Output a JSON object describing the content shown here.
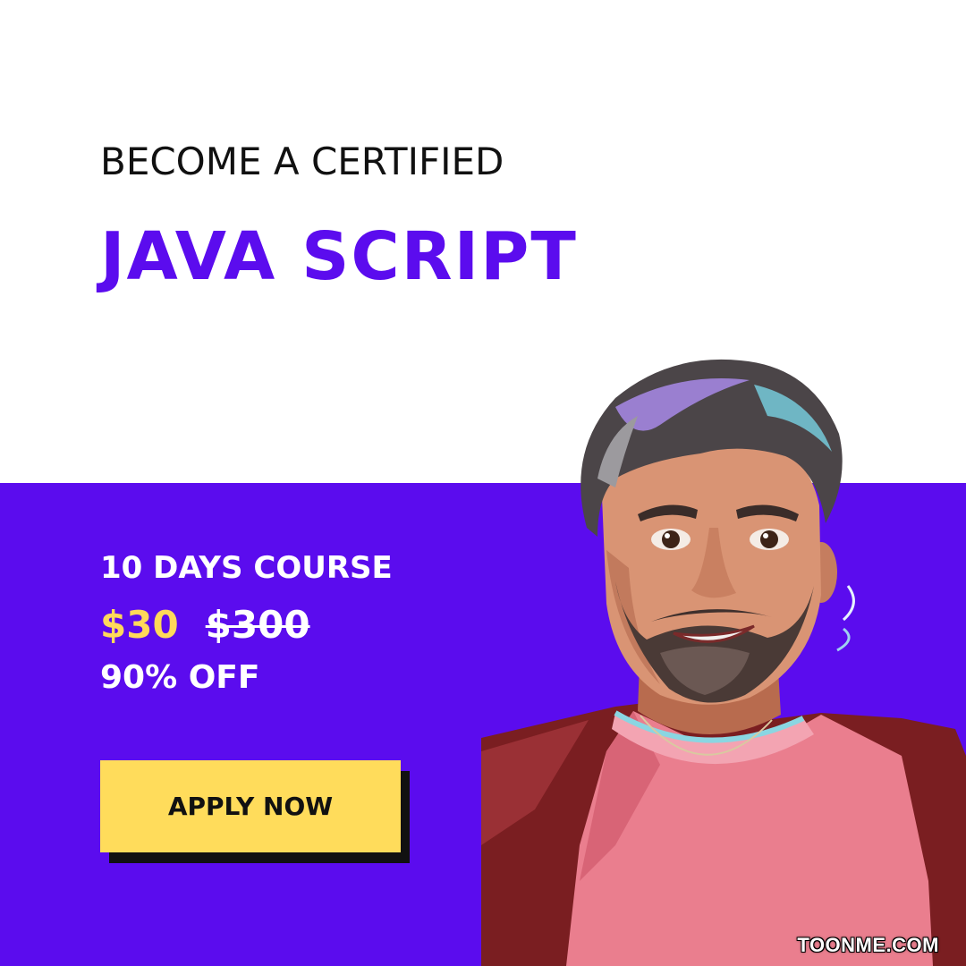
{
  "colors": {
    "brand_purple": "#5b0cee",
    "price_yellow": "#ffd95a",
    "button_yellow": "#ffdc5b",
    "text_dark": "#111111"
  },
  "header": {
    "eyebrow": "BECOME A CERTIFIED",
    "headline": "JAVA SCRIPT"
  },
  "offer": {
    "course": "10 DAYS COURSE",
    "price_now": "$30",
    "price_old": "$300",
    "discount": "90% OFF"
  },
  "cta": {
    "label": "APPLY NOW"
  },
  "illustration": {
    "subject": "cartoon-portrait",
    "watermark": "TOONME.COM"
  }
}
